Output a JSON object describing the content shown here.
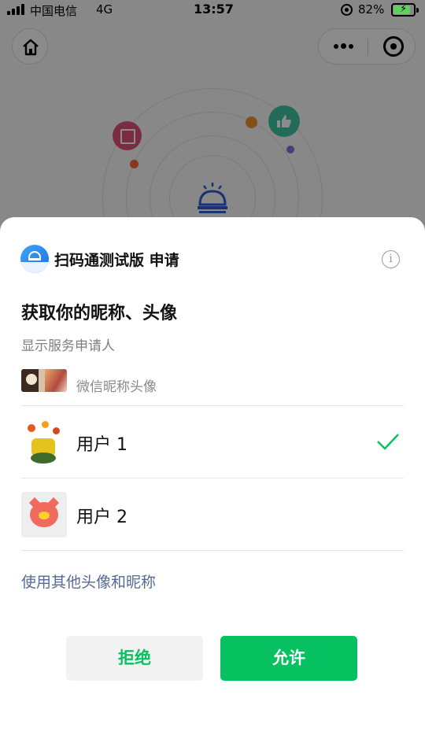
{
  "status_bar": {
    "carrier": "中国电信",
    "network": "4G",
    "time": "13:57",
    "battery_percent": "82%",
    "battery_level": 0.82
  },
  "background_app": {
    "icons": [
      "home-icon",
      "more-icon",
      "close-icon",
      "scan-icon",
      "thumbs-up-icon",
      "service-bell-icon"
    ]
  },
  "sheet": {
    "app_name": "扫码通测试版 申请",
    "info_icon": "i",
    "title": "获取你的昵称、头像",
    "subtitle": "显示服务申请人",
    "preview_label": "微信昵称头像",
    "users": [
      {
        "name": "用户 1",
        "selected": true
      },
      {
        "name": "用户 2",
        "selected": false
      }
    ],
    "other_link": "使用其他头像和昵称",
    "reject_label": "拒绝",
    "allow_label": "允许"
  },
  "colors": {
    "accent_green": "#07c160",
    "link_blue": "#576b95"
  }
}
